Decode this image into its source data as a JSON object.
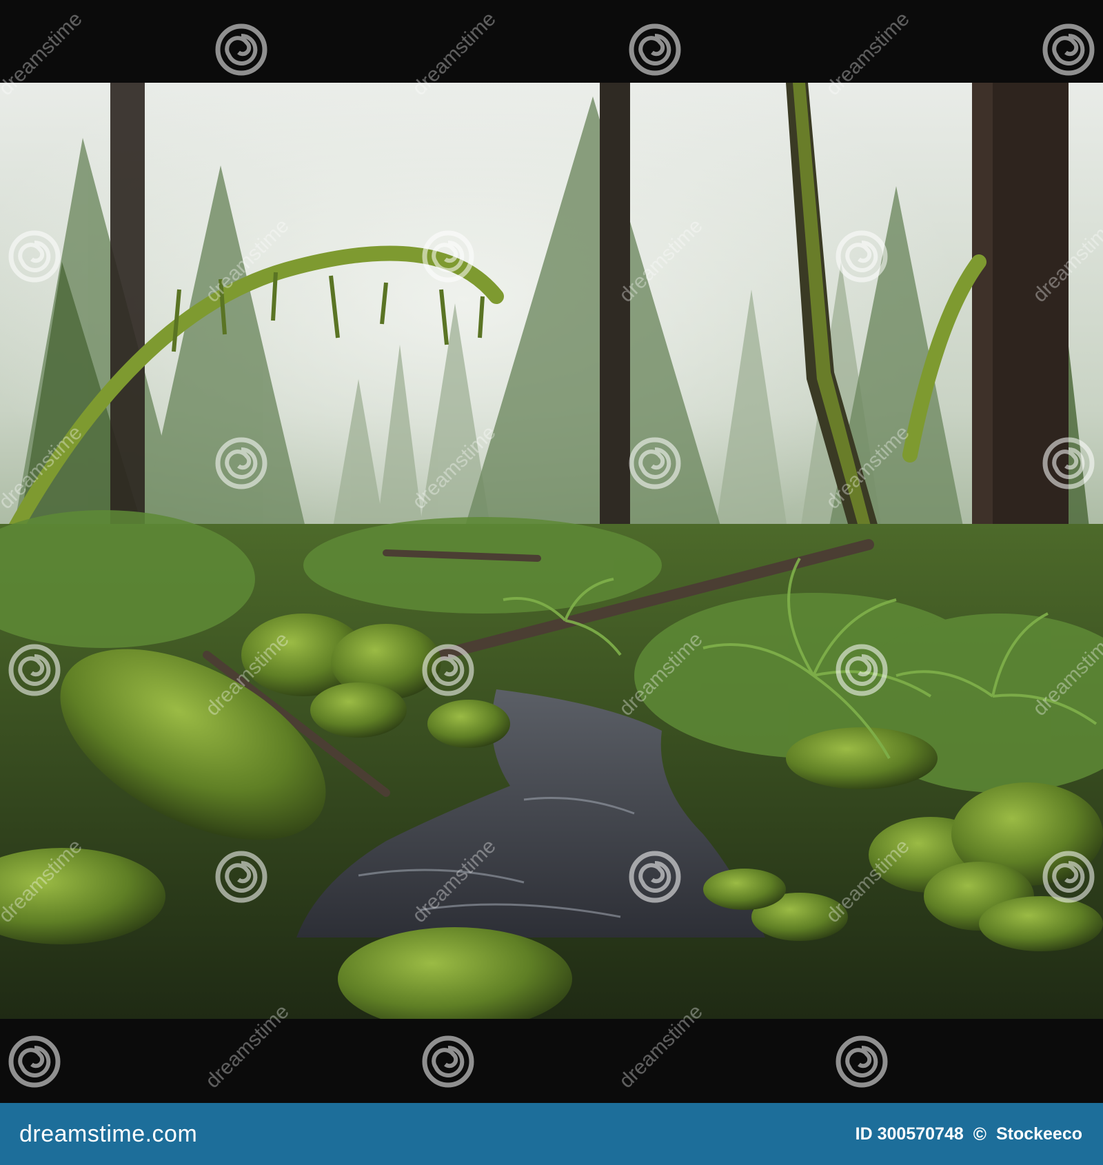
{
  "photo": {
    "subject": "moss-covered temperate rainforest with a creek",
    "colors": {
      "moss": "#6f8f2e",
      "fog": "#d9ded6",
      "water": "#4a4c57",
      "bark": "#2a2420"
    }
  },
  "watermark": {
    "text": "dreamstime",
    "icon": "spiral-logo-icon"
  },
  "footer": {
    "brand": "dreamstime.com",
    "image_id": "ID 300570748",
    "copyright_symbol": "©",
    "author": "Stockeeco",
    "background": "#1d6e9a"
  }
}
